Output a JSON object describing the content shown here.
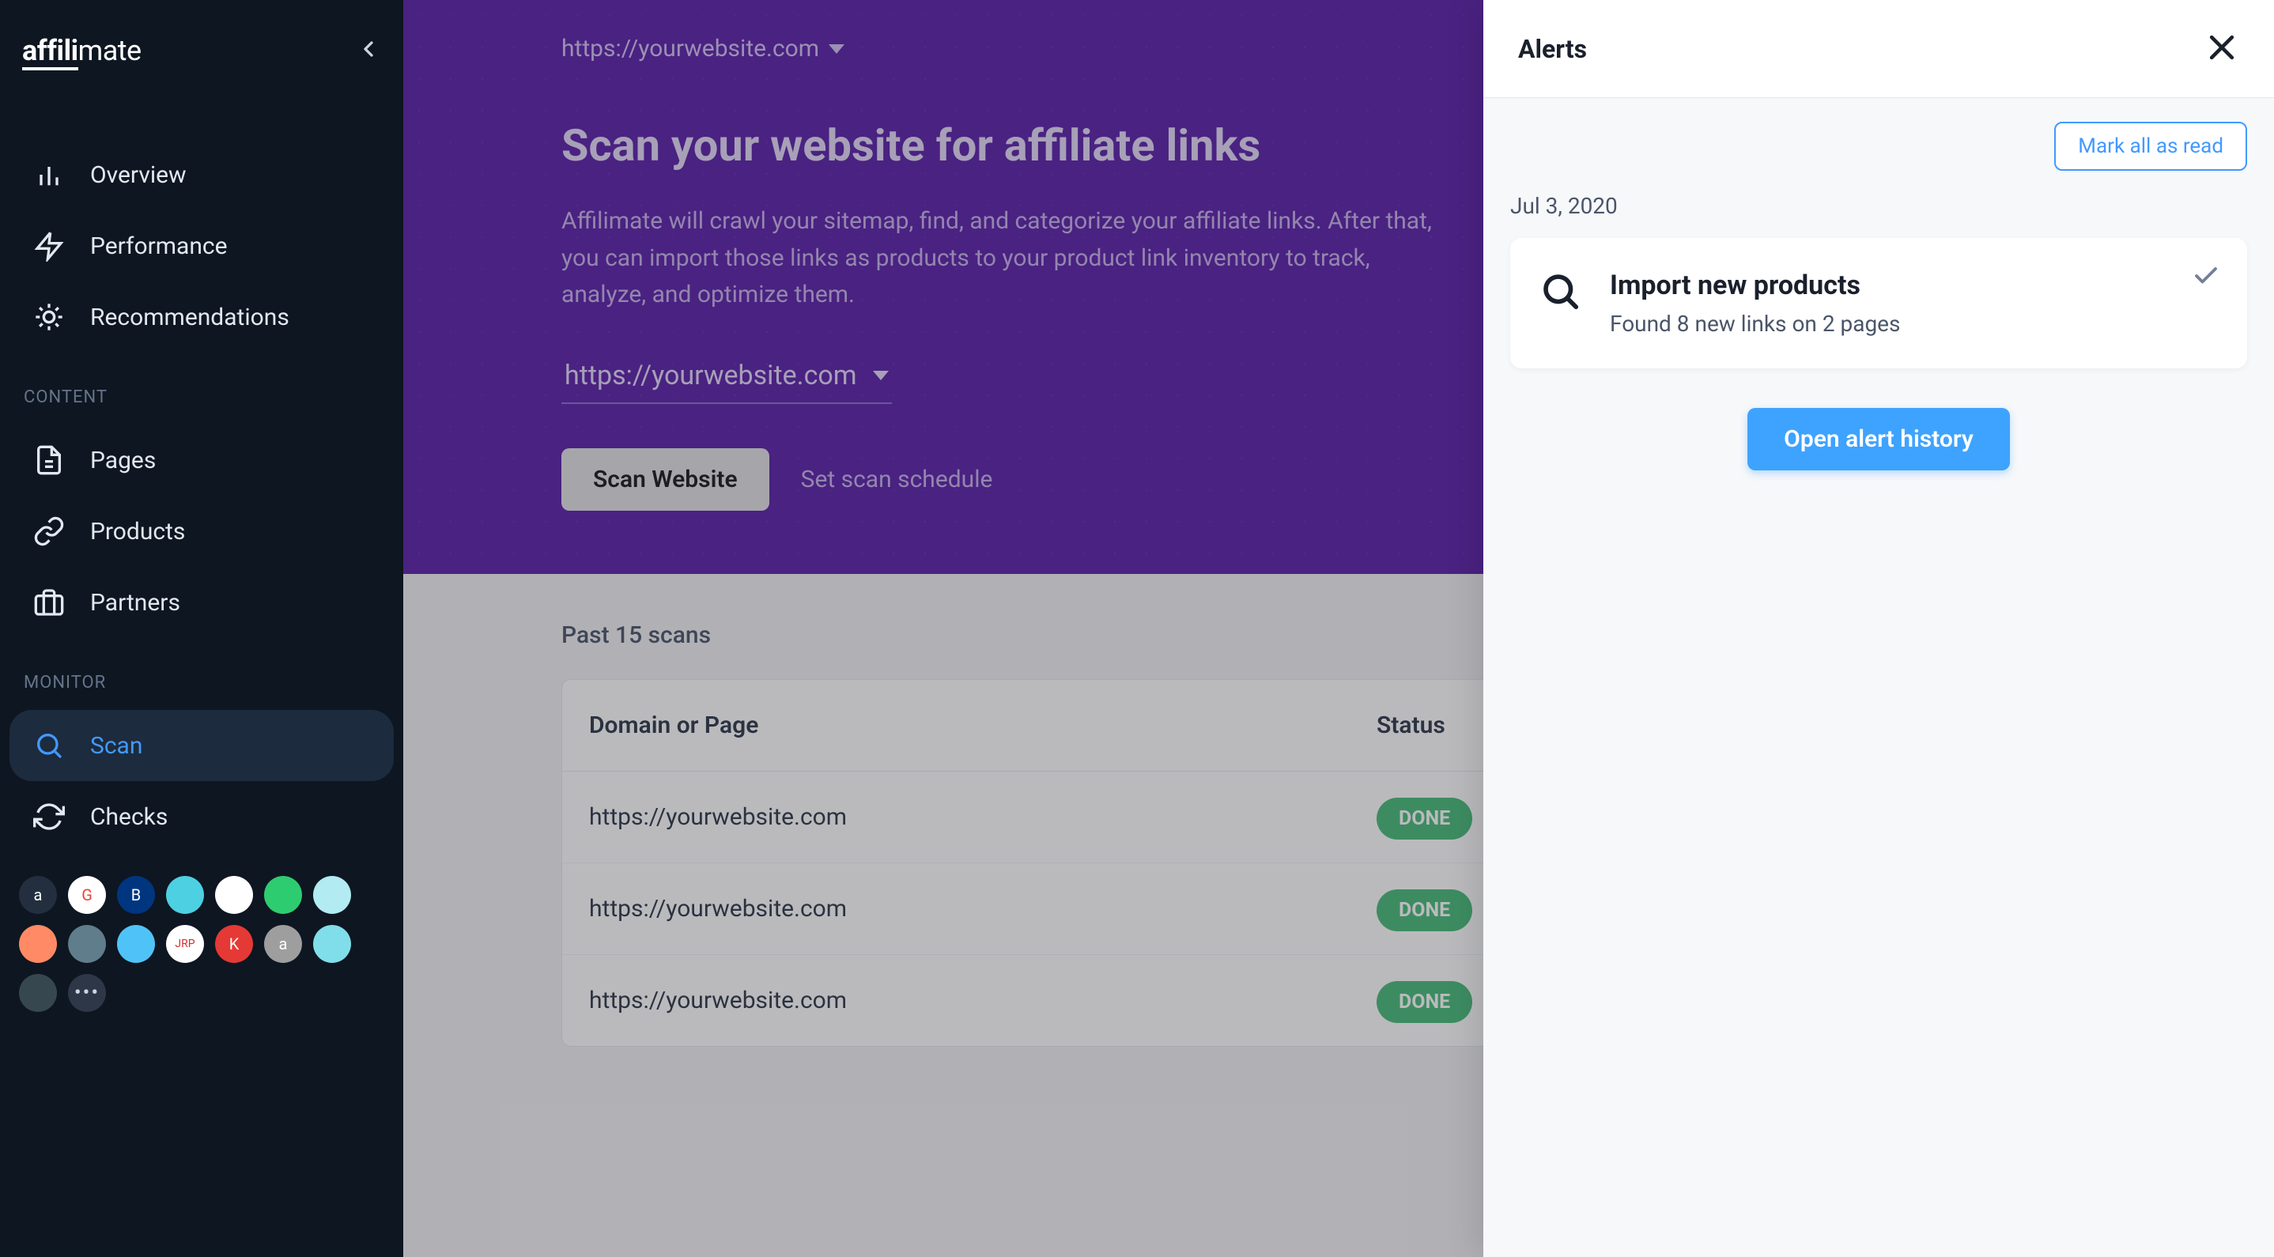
{
  "logo": {
    "part1": "affili",
    "part2": "mate"
  },
  "sidebar": {
    "items": [
      {
        "label": "Overview"
      },
      {
        "label": "Performance"
      },
      {
        "label": "Recommendations"
      }
    ],
    "sections": {
      "content_label": "CONTENT",
      "content_items": [
        {
          "label": "Pages"
        },
        {
          "label": "Products"
        },
        {
          "label": "Partners"
        }
      ],
      "monitor_label": "MONITOR",
      "monitor_items": [
        {
          "label": "Scan"
        },
        {
          "label": "Checks"
        }
      ]
    },
    "partner_dots": [
      "a",
      "G",
      "B",
      "",
      "",
      "",
      "",
      "",
      "",
      "",
      "JRP",
      "K",
      "a",
      "",
      "..."
    ]
  },
  "hero": {
    "site_url": "https://yourwebsite.com",
    "title": "Scan your website for affiliate links",
    "description": "Affilimate will crawl your sitemap, find, and categorize your affiliate links. After that, you can import those links as products to your product link inventory to track, analyze, and optimize them.",
    "select_value": "https://yourwebsite.com",
    "scan_button": "Scan Website",
    "schedule_link": "Set scan schedule"
  },
  "scans": {
    "heading": "Past 15 scans",
    "columns": {
      "domain": "Domain or Page",
      "status": "Status"
    },
    "rows": [
      {
        "domain": "https://yourwebsite.com",
        "status": "DONE"
      },
      {
        "domain": "https://yourwebsite.com",
        "status": "DONE"
      },
      {
        "domain": "https://yourwebsite.com",
        "status": "DONE"
      }
    ]
  },
  "alerts": {
    "title": "Alerts",
    "mark_all": "Mark all as read",
    "date": "Jul 3, 2020",
    "card": {
      "title": "Import new products",
      "subtitle": "Found 8 new links on 2 pages"
    },
    "history_button": "Open alert history"
  },
  "colors": {
    "purple": "#5a1fa8",
    "blue": "#3ea3ff",
    "green": "#48bb78"
  }
}
